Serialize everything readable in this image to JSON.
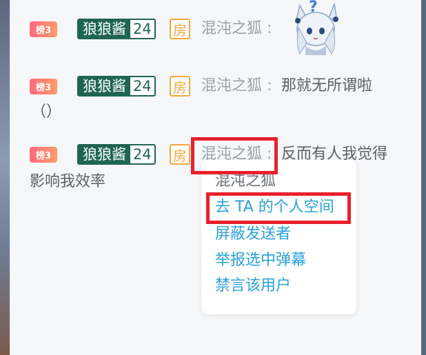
{
  "messages": [
    {
      "rank": "榜3",
      "medal_name": "狼狼酱",
      "medal_level": "24",
      "room": "房",
      "user": "混沌之狐 :",
      "text": "",
      "cont": "",
      "sticker": "question-fox-girl-sticker"
    },
    {
      "rank": "榜3",
      "medal_name": "狼狼酱",
      "medal_level": "24",
      "room": "房",
      "user": "混沌之狐 :",
      "text": "那就无所谓啦",
      "cont": "（）"
    },
    {
      "rank": "榜3",
      "medal_name": "狼狼酱",
      "medal_level": "24",
      "room": "房",
      "user": "混沌之狐 :",
      "text": "反而有人我觉得",
      "cont": "影响我效率"
    }
  ],
  "context_menu": {
    "header": "混沌之狐",
    "items": [
      "去 TA 的个人空间",
      "屏蔽发送者",
      "举报选中弹幕",
      "禁言该用户"
    ]
  },
  "colors": {
    "highlight": "#e8212c",
    "link": "#2aa0dd",
    "medal": "#1e6552",
    "room": "#f2a73a"
  }
}
